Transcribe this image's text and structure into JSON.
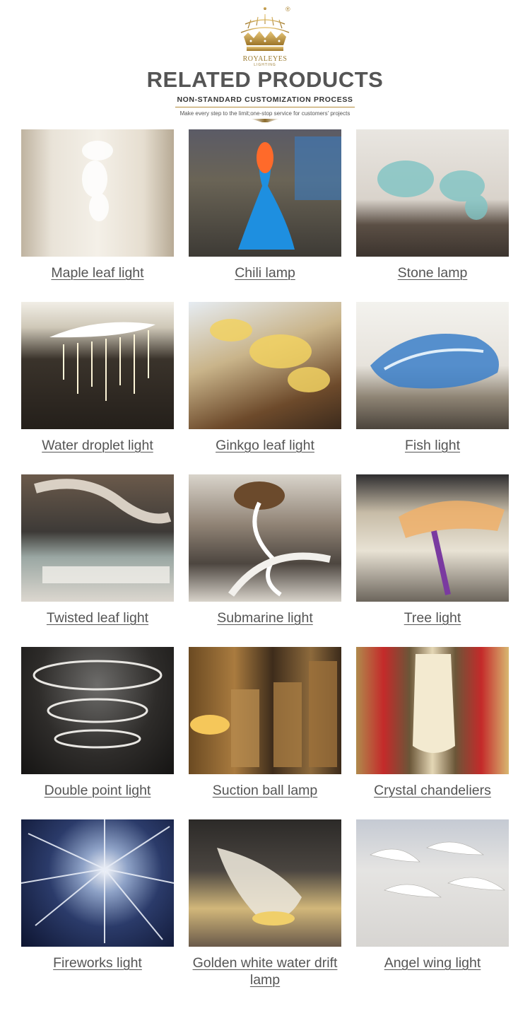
{
  "header": {
    "brand": "ROYALEYES",
    "brand_sub": "LIGHTING",
    "registered": "®",
    "title": "RELATED PRODUCTS",
    "subtitle": "NON-STANDARD CUSTOMIZATION PROCESS",
    "description": "Make every step to the limit;one-stop service for customers' projects",
    "logo_icon": "crown-chandelier-logo",
    "accent_color": "#b38b3a"
  },
  "products": [
    {
      "label": "Maple leaf light"
    },
    {
      "label": "Chili lamp"
    },
    {
      "label": "Stone lamp"
    },
    {
      "label": "Water droplet light"
    },
    {
      "label": "Ginkgo leaf light"
    },
    {
      "label": "Fish light"
    },
    {
      "label": "Twisted leaf light"
    },
    {
      "label": "Submarine light"
    },
    {
      "label": "Tree light"
    },
    {
      "label": "Double point light"
    },
    {
      "label": "Suction ball lamp"
    },
    {
      "label": "Crystal chandeliers"
    },
    {
      "label": "Fireworks light"
    },
    {
      "label": "Golden white water drift lamp"
    },
    {
      "label": "Angel wing light"
    }
  ]
}
